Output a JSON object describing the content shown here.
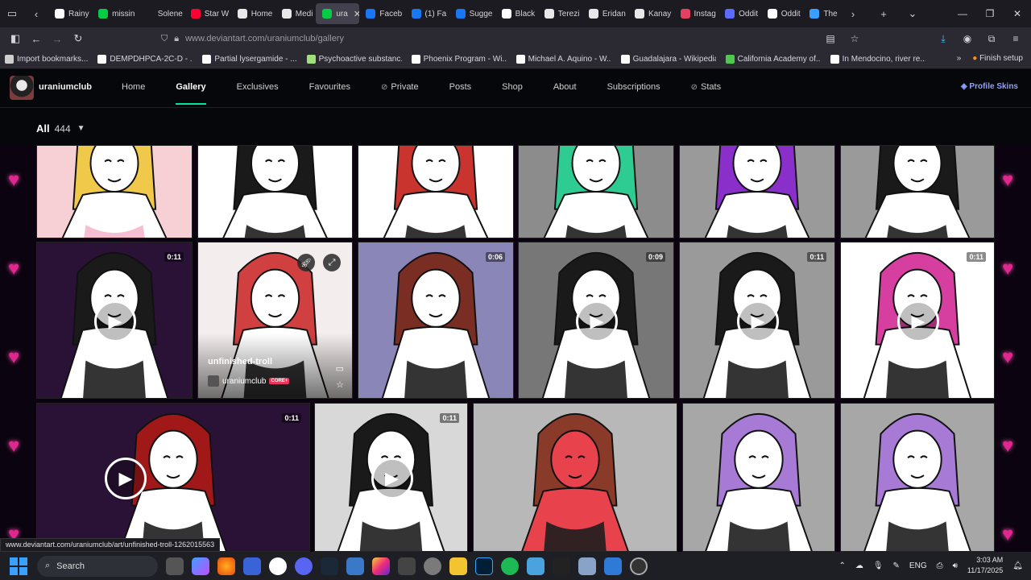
{
  "browser": {
    "tabs": [
      {
        "label": "Rainy",
        "color": "#ffffff"
      },
      {
        "label": "missin",
        "color": "#05cc47"
      },
      {
        "label": "Solene",
        "color": "#1c1b22"
      },
      {
        "label": "Star W",
        "color": "#ff0033"
      },
      {
        "label": "Home",
        "color": "#e8e8e8"
      },
      {
        "label": "Medi",
        "color": "#e8e8e8"
      },
      {
        "label": "ura",
        "color": "#05cc47",
        "active": true
      },
      {
        "label": "Faceb",
        "color": "#1877f2"
      },
      {
        "label": "(1) Fa",
        "color": "#1877f2"
      },
      {
        "label": "Sugge",
        "color": "#1877f2"
      },
      {
        "label": "Black",
        "color": "#ffffff"
      },
      {
        "label": "Terezi",
        "color": "#e8e8e8"
      },
      {
        "label": "Eridan",
        "color": "#e8e8e8"
      },
      {
        "label": "Kanay",
        "color": "#e8e8e8"
      },
      {
        "label": "Instag",
        "color": "#e4405f"
      },
      {
        "label": "Oddit",
        "color": "#5b6bff"
      },
      {
        "label": "Oddit",
        "color": "#ffffff"
      },
      {
        "label": "The",
        "color": "#3aa0ff"
      }
    ],
    "url": "www.deviantart.com/uraniumclub/gallery",
    "bookmarks": [
      "Import bookmarks...",
      "DEMPDHPCA-2C-D - ...",
      "Partial lysergamide - ...",
      "Psychoactive substanc...",
      "Phoenix Program - Wi...",
      "Michael A. Aquino - W...",
      "Guadalajara - Wikipedia",
      "California Academy of...",
      "In Mendocino, river re..."
    ],
    "finish_setup": "Finish setup"
  },
  "deviantart": {
    "username": "uraniumclub",
    "nav": [
      "Home",
      "Gallery",
      "Exclusives",
      "Favourites",
      "Private",
      "Posts",
      "Shop",
      "About",
      "Subscriptions",
      "Stats"
    ],
    "profile_skins": "Profile Skins",
    "gallery_label": "All",
    "gallery_count": "444"
  },
  "tiles": [
    {
      "duration": "",
      "bg": "#f7d0d6",
      "hair": "#f0c94a"
    },
    {
      "duration": "",
      "bg": "#ffffff",
      "hair": "#1a1a1a"
    },
    {
      "duration": "",
      "bg": "#ffffff",
      "hair": "#c9342f"
    },
    {
      "duration": "",
      "bg": "#8c8c8c",
      "hair": "#2ecb92"
    },
    {
      "duration": "",
      "bg": "#9a9a9a",
      "hair": "#8a2fc9"
    },
    {
      "duration": "",
      "bg": "#9a9a9a",
      "hair": "#1a1a1a"
    },
    {
      "duration": "0:11",
      "bg": "#2a1236",
      "hair": "#1a1a1a"
    },
    {
      "duration": "",
      "bg": "#f3eded",
      "hair": "#d04040"
    },
    {
      "duration": "0:06",
      "bg": "#8a86b8",
      "hair": "#7a2d22"
    },
    {
      "duration": "0:09",
      "bg": "#777777",
      "hair": "#1a1a1a"
    },
    {
      "duration": "0:11",
      "bg": "#9a9a9a",
      "hair": "#1a1a1a"
    },
    {
      "duration": "0:11",
      "bg": "#ffffff",
      "hair": "#d63fa0"
    },
    {
      "duration": "0:11",
      "bg": "#2a1236",
      "hair": "#a01818"
    },
    {
      "duration": "0:11",
      "bg": "#d8d8d8",
      "hair": "#1a1a1a"
    },
    {
      "duration": "",
      "bg": "#b8b8b8",
      "hair": "#8a3a28"
    },
    {
      "duration": "",
      "bg": "#a7a7a7",
      "hair": "#a77ad6"
    },
    {
      "duration": "",
      "bg": "#a7a7a7",
      "hair": "#a77ad6"
    }
  ],
  "hover": {
    "title": "unfinished-troll",
    "user": "uraniumclub",
    "badge": "CORE+"
  },
  "status_url": "www.deviantart.com/uraniumclub/art/unfinished-troll-1262015563",
  "taskbar": {
    "search": "Search",
    "lang": "ENG",
    "time": "3:03 AM",
    "date": "11/17/2025"
  }
}
